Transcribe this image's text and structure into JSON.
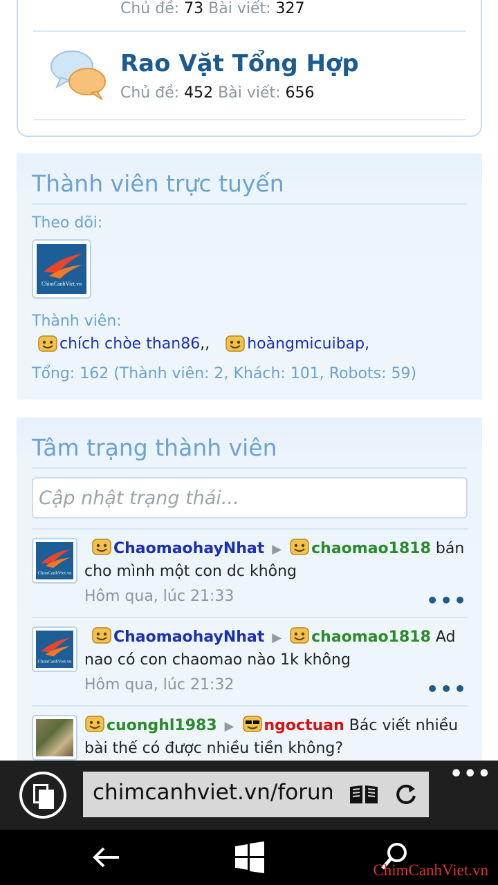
{
  "forum": {
    "prev_row": {
      "topics_label": "Chủ đề:",
      "topics": "73",
      "posts_label": "Bài viết:",
      "posts": "327"
    },
    "title": "Rao Vặt Tổng Hợp",
    "topics_label": "Chủ đề:",
    "topics": "452",
    "posts_label": "Bài viết:",
    "posts": "656"
  },
  "online": {
    "title": "Thành viên trực tuyến",
    "following_label": "Theo dõi:",
    "logo_text": "ChimCanhViet.vn",
    "members_label": "Thành viên:",
    "members": [
      "chích chòe than86",
      "hoàngmicuibap"
    ],
    "separator": ",,",
    "trailing": ",",
    "totals": "Tổng: 162 (Thành viên: 2, Khách: 101, Robots: 59)"
  },
  "mood": {
    "title": "Tâm trạng thành viên",
    "input_placeholder": "Cập nhật trạng thái...",
    "posts": [
      {
        "from": "ChaomaohayNhat",
        "to": "chaomao1818",
        "text": "bán cho mình một con dc không",
        "time": "Hôm qua, lúc 21:33"
      },
      {
        "from": "ChaomaohayNhat",
        "to": "chaomao1818",
        "text": "Ad nao có con chaomao nào 1k không",
        "time": "Hôm qua, lúc 21:32"
      },
      {
        "from": "cuonghl1983",
        "to": "ngoctuan",
        "text": "Bác viết nhiều bài thế có được nhiều tiền không?",
        "time": ""
      }
    ],
    "more": "•••",
    "arrow": "▶"
  },
  "browser": {
    "url": "chimcanhviet.vn/forum",
    "more": "•••"
  },
  "watermark": "ChimCanhViet.vn",
  "colors": {
    "accent": "#1d5b8e",
    "panel_title": "#6ba2cf",
    "user_blue": "#1b2fb5",
    "user_green": "#2b8a2b",
    "user_red": "#d41313"
  }
}
